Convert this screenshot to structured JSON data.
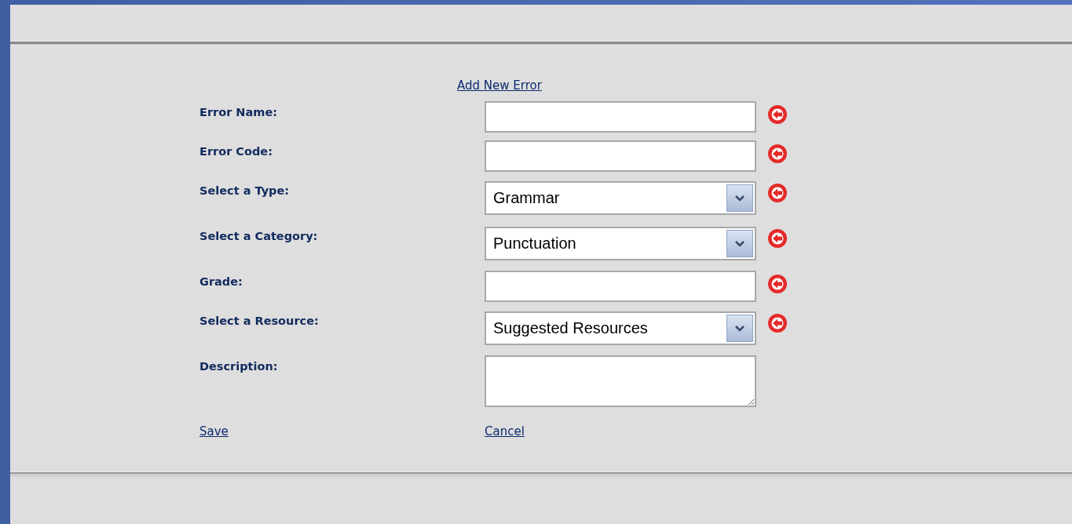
{
  "form": {
    "title_link": "Add New Error",
    "fields": [
      {
        "label": "Error Name:",
        "kind": "text",
        "required": true
      },
      {
        "label": "Error Code:",
        "kind": "text",
        "required": true
      },
      {
        "label": "Select a Type:",
        "kind": "select",
        "value": "Grammar",
        "required": true
      },
      {
        "label": "Select a Category:",
        "kind": "select",
        "value": "Punctuation",
        "required": true
      },
      {
        "label": "Grade:",
        "kind": "text",
        "required": true
      },
      {
        "label": "Select a Resource:",
        "kind": "select",
        "value": "Suggested Resources",
        "required": true
      },
      {
        "label": "Description:",
        "kind": "textarea",
        "required": false
      }
    ],
    "actions": [
      {
        "label": "Save"
      },
      {
        "label": "Cancel"
      }
    ]
  }
}
